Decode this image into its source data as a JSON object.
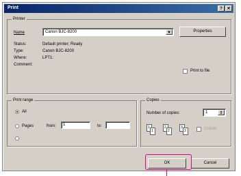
{
  "window": {
    "title": "Print"
  },
  "printer": {
    "group_label": "Printer",
    "name_label": "Name",
    "name_value": "Canon BJC-8200",
    "properties_button": "Properties",
    "status_label": "Status:",
    "status_value": "Default printer; Ready",
    "type_label": "Type:",
    "type_value": "Canon BJC-8200",
    "where_label": "Where:",
    "where_value": "LPT1:",
    "comment_label": "Comment:",
    "print_to_file_label": "Print to file"
  },
  "print_range": {
    "group_label": "Print range",
    "all_label": "All",
    "pages_label": "Pages",
    "from_label": "from:",
    "from_value": "1",
    "to_label": "to:",
    "to_value": "",
    "selection_label": ""
  },
  "copies": {
    "group_label": "Copies",
    "number_label": "Number of copies:",
    "number_value": "1",
    "collate_label": "Collate",
    "page_icons": [
      "1",
      "1",
      "2",
      "2",
      "3",
      "3"
    ]
  },
  "buttons": {
    "ok": "OK",
    "cancel": "Cancel"
  },
  "colors": {
    "highlight": "#e0008a",
    "titlebar": "#0a246a"
  }
}
